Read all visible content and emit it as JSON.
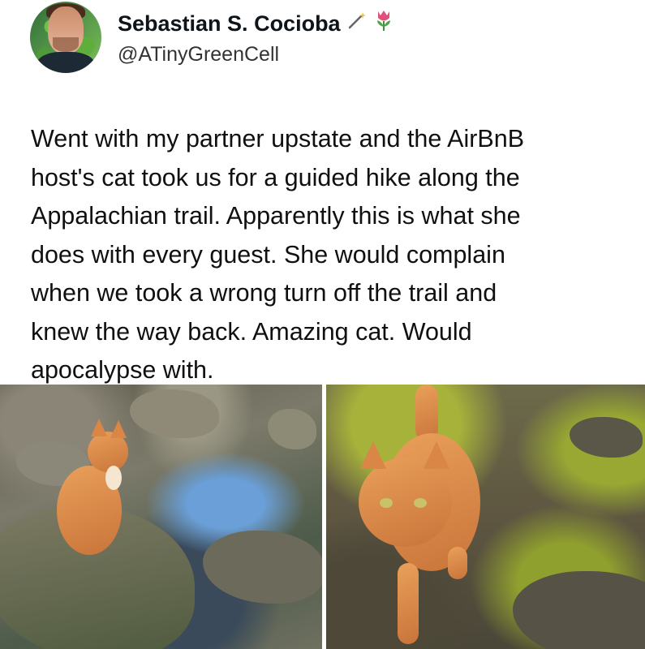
{
  "author": {
    "display_name": "Sebastian S. Cocioba",
    "handle": "@ATinyGreenCell",
    "emojis": [
      {
        "name": "magic-wand-icon",
        "glyph": "✨"
      },
      {
        "name": "tulip-icon",
        "glyph": "❀"
      }
    ]
  },
  "tweet": {
    "lines": [
      "Went with my partner upstate and the AirBnB",
      "host's cat took us for a guided hike along the",
      "Appalachian trail. Apparently this is what she",
      "does with every guest. She would complain",
      "when we took a wrong turn off the trail and",
      "knew the way back. Amazing cat. Would",
      "apocalypse with."
    ]
  },
  "photos": [
    {
      "name": "cat-on-rock-by-stream"
    },
    {
      "name": "cat-walking-on-moss-trail"
    }
  ]
}
